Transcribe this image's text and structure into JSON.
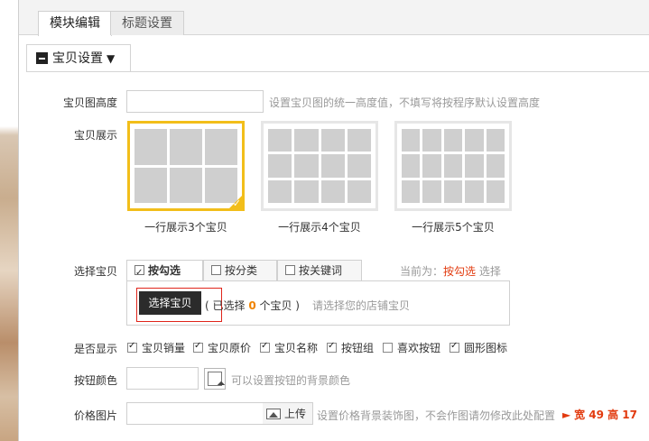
{
  "tabs": [
    {
      "label": "模块编辑",
      "active": true
    },
    {
      "label": "标题设置",
      "active": false
    }
  ],
  "section": {
    "title": "宝贝设置",
    "caret": "▼"
  },
  "height_row": {
    "label": "宝贝图高度",
    "value": "",
    "hint": "设置宝贝图的统一高度值，不填写将按程序默认设置高度"
  },
  "display_row": {
    "label": "宝贝展示",
    "options": [
      {
        "caption": "一行展示3个宝贝",
        "columns": 3,
        "selected": true
      },
      {
        "caption": "一行展示4个宝贝",
        "columns": 4,
        "selected": false
      },
      {
        "caption": "一行展示5个宝贝",
        "columns": 5,
        "selected": false
      }
    ]
  },
  "choose_row": {
    "label": "选择宝贝",
    "tabs": [
      {
        "label": "按勾选",
        "checked": true,
        "active": true
      },
      {
        "label": "按分类",
        "checked": false,
        "active": false
      },
      {
        "label": "按关键词",
        "checked": false,
        "active": false
      }
    ],
    "current_prefix": "当前为：",
    "current_mode": "按勾选",
    "current_suffix": "选择",
    "button_label": "选择宝贝",
    "selected_open": "( 已选择 ",
    "selected_count": "0",
    "selected_close": " 个宝贝 )",
    "hint": "请选择您的店铺宝贝"
  },
  "show_row": {
    "label": "是否显示",
    "options": [
      {
        "label": "宝贝销量",
        "checked": true
      },
      {
        "label": "宝贝原价",
        "checked": true
      },
      {
        "label": "宝贝名称",
        "checked": true
      },
      {
        "label": "按钮组",
        "checked": true
      },
      {
        "label": "喜欢按钮",
        "checked": false
      },
      {
        "label": "圆形图标",
        "checked": true
      }
    ]
  },
  "button_color_row": {
    "label": "按钮颜色",
    "value": "",
    "hint": "可以设置按钮的背景颜色"
  },
  "price_image_row": {
    "label": "价格图片",
    "value": "",
    "upload_label": "上传",
    "hint": "设置价格背景装饰图，不会作图请勿修改此处配置",
    "size_arrow": "►",
    "size_text": "宽 49 高 17"
  },
  "colors": {
    "selected_border": "#f2be1a",
    "accent_orange": "#f08300",
    "accent_red": "#e23b0f",
    "button_dark": "#2b2b2b"
  }
}
